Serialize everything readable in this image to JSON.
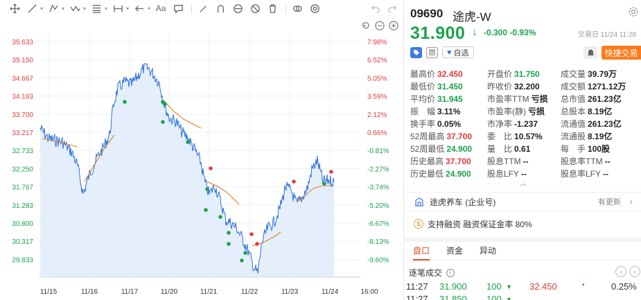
{
  "chart": {
    "price_ticks": [
      "35.633",
      "35.150",
      "34.667",
      "34.183",
      "33.700",
      "33.217",
      "32.733",
      "32.250",
      "31.767",
      "31.283",
      "30.800",
      "30.317",
      "29.833"
    ],
    "pct_ticks": [
      "7.98%",
      "6.52%",
      "5.05%",
      "3.59%",
      "2.12%",
      "0.66%",
      "-0.81%",
      "-2.27%",
      "-3.74%",
      "-5.20%",
      "-6.67%",
      "-8.13%",
      "-9.60%"
    ],
    "date_ticks": [
      "11/15",
      "11/16",
      "11/17",
      "11/20",
      "11/21",
      "11/22",
      "11/23",
      "11/24",
      "16:00"
    ],
    "colors": {
      "price_line": "#2b6fe0",
      "avg_line": "#e07b1c",
      "up": "#e63a3a",
      "down": "#1aa34a",
      "area": "#dce9fb"
    }
  },
  "quote": {
    "code": "09690",
    "name": "途虎-W",
    "price": "31.900",
    "change": "-0.300",
    "change_pct": "-0.93%",
    "time": "交易日 11/24 11:28",
    "watch_label": "自选",
    "fast_trade": "快捷交易",
    "stats": [
      [
        {
          "label": "最高价",
          "value": "32.450",
          "color": "up"
        },
        {
          "label": "开盘价",
          "value": "31.750",
          "color": "down"
        },
        {
          "label": "成交量",
          "value": "39.79万",
          "color": ""
        }
      ],
      [
        {
          "label": "最低价",
          "value": "31.450",
          "color": "down"
        },
        {
          "label": "昨收价",
          "value": "32.200",
          "color": ""
        },
        {
          "label": "成交额",
          "value": "1271.12万",
          "color": ""
        }
      ],
      [
        {
          "label": "平均价",
          "value": "31.945",
          "color": "down"
        },
        {
          "label": "市盈率TTM",
          "value": "亏损",
          "color": ""
        },
        {
          "label": "总市值",
          "value": "261.23亿",
          "color": ""
        }
      ],
      [
        {
          "label": "振　幅",
          "value": "3.11%",
          "color": ""
        },
        {
          "label": "市盈率(静)",
          "value": "亏损",
          "color": ""
        },
        {
          "label": "总股本",
          "value": "8.19亿",
          "color": ""
        }
      ],
      [
        {
          "label": "换手率",
          "value": "0.05%",
          "color": ""
        },
        {
          "label": "市净率",
          "value": "-1.237",
          "color": ""
        },
        {
          "label": "流通值",
          "value": "261.23亿",
          "color": ""
        }
      ],
      [
        {
          "label": "52周最高",
          "value": "37.700",
          "color": "up"
        },
        {
          "label": "委　比",
          "value": "10.57%",
          "color": ""
        },
        {
          "label": "流通股",
          "value": "8.19亿",
          "color": ""
        }
      ],
      [
        {
          "label": "52周最低",
          "value": "24.900",
          "color": "down"
        },
        {
          "label": "量　比",
          "value": "0.61",
          "color": ""
        },
        {
          "label": "每　手",
          "value": "100股",
          "color": ""
        }
      ],
      [
        {
          "label": "历史最高",
          "value": "37.700",
          "color": "up"
        },
        {
          "label": "股息TTM",
          "value": "--",
          "color": ""
        },
        {
          "label": "股息率TTM",
          "value": "--",
          "color": ""
        }
      ],
      [
        {
          "label": "历史最低",
          "value": "24.900",
          "color": "down"
        },
        {
          "label": "股息LFY",
          "value": "--",
          "color": ""
        },
        {
          "label": "股息率LFY",
          "value": "--",
          "color": ""
        }
      ]
    ],
    "news_label": "途虎养车 (企业号)",
    "news_more": "有更新",
    "financing_label": "支持融资  融资保证金率 80%",
    "tabs": [
      "盘口",
      "资金",
      "异动"
    ],
    "trades_title": "逐笔成交",
    "trades": [
      {
        "time": "11:27",
        "price": "31.900",
        "volume": "100",
        "price2": "32.450",
        "pct": "0.25%"
      },
      {
        "time": "11:27",
        "price": "31.850",
        "volume": "100",
        "price2": "",
        "pct": ""
      }
    ]
  }
}
